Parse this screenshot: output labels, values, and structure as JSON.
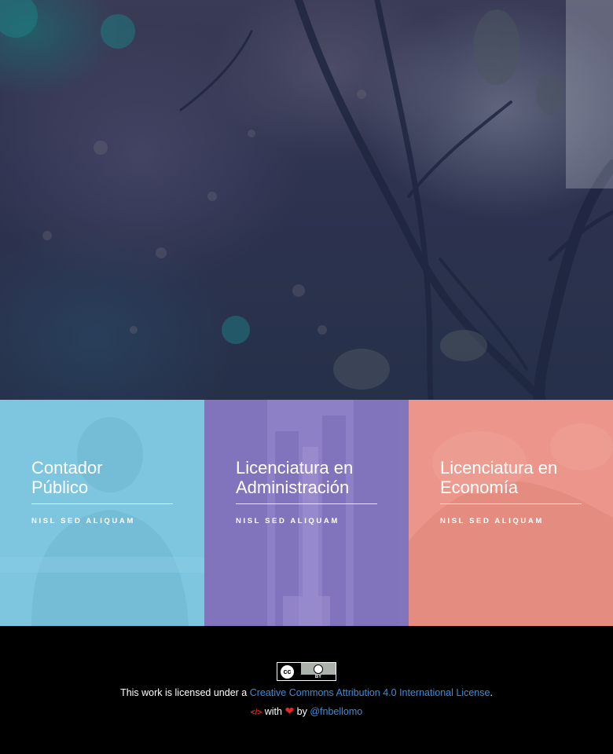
{
  "hero": {
    "image": "blurred-tree-branches-photo"
  },
  "cards": [
    {
      "title_line1": "Contador",
      "title_line2": "Público",
      "tag": "NISL SED ALIQUAM",
      "color": "#7ec5e0",
      "image": "person-in-hat-photo"
    },
    {
      "title_line1": "Licenciatura en",
      "title_line2": "Administración",
      "tag": "NISL SED ALIQUAM",
      "color": "#8e80c7",
      "image": "city-street-photo"
    },
    {
      "title_line1": "Licenciatura en",
      "title_line2": "Economía",
      "tag": "NISL SED ALIQUAM",
      "color": "#ec958a",
      "image": "landscape-photo"
    }
  ],
  "footer": {
    "badge_icon": "cc-by-icon",
    "license_prefix": "This work is licensed under a ",
    "license_link": "Creative Commons Attribution 4.0 International License",
    "license_suffix": ".",
    "made_with": "with",
    "by": "by",
    "author": "@fnbellomo",
    "link_color": "#3a8dde",
    "icon_color": "#e8281f"
  }
}
